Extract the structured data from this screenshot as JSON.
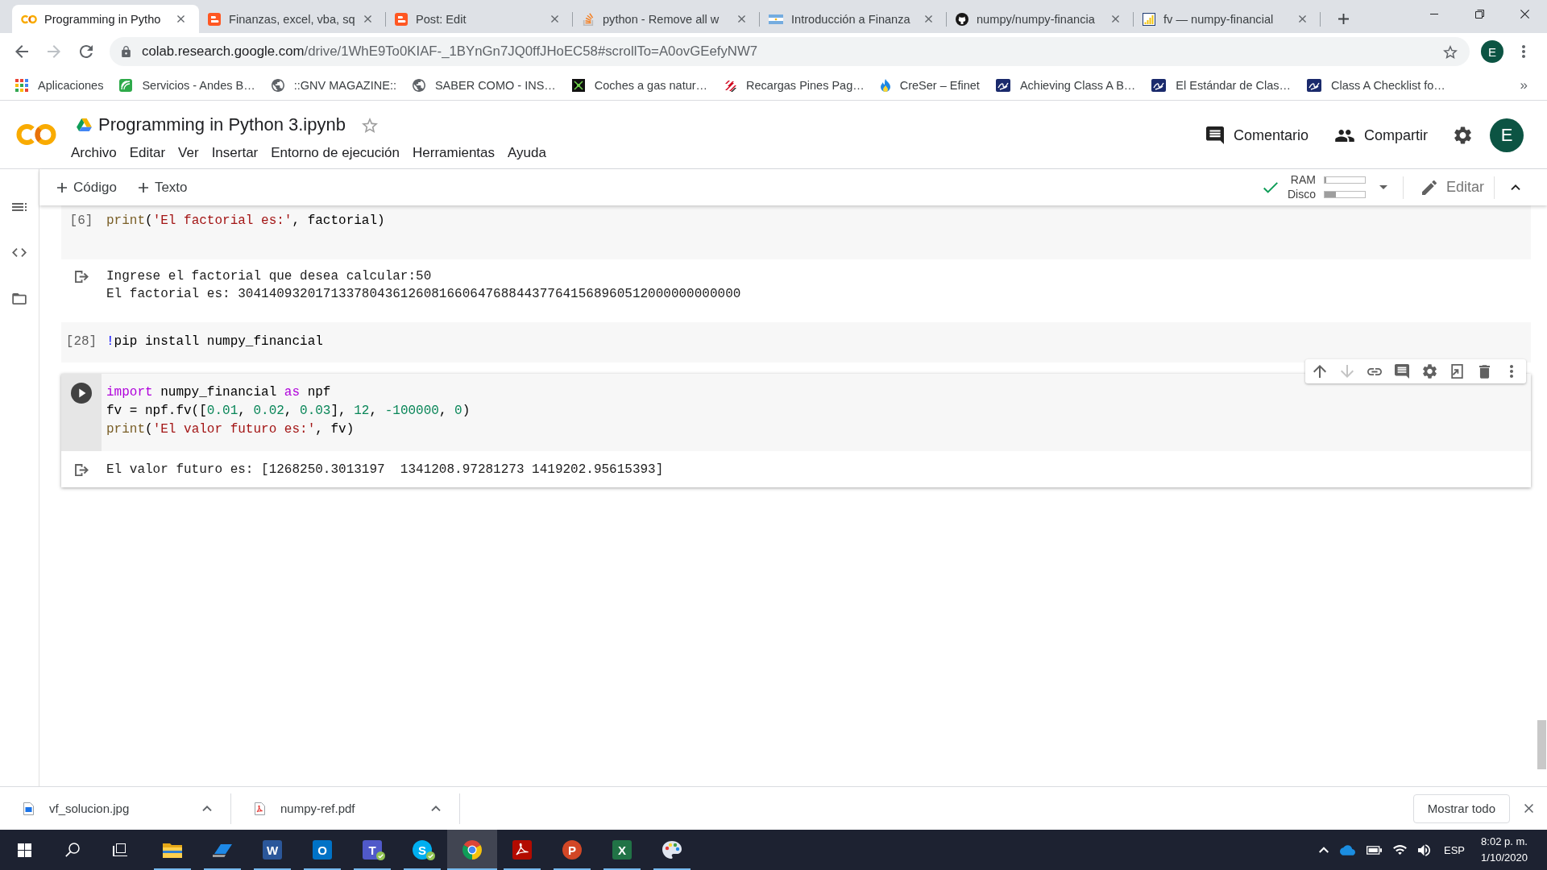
{
  "browser": {
    "tabs": [
      {
        "kind": "rings",
        "title": "Programming in Pytho",
        "selected": true
      },
      {
        "kind": "tile",
        "title": "Finanzas, excel, vba, sq",
        "selected": false
      },
      {
        "kind": "tile",
        "title": "Post: Edit",
        "selected": false
      },
      {
        "kind": "tray",
        "title": "python - Remove all w",
        "selected": false
      },
      {
        "kind": "flag",
        "title": "Introducción a Finanza",
        "selected": false
      },
      {
        "kind": "cat",
        "title": "numpy/numpy-financia",
        "selected": false
      },
      {
        "kind": "bars",
        "title": "fv — numpy-financial",
        "selected": false
      }
    ],
    "forward_disabled": true,
    "url": {
      "host": "colab.research.google.com",
      "path": "/drive/1WhE9To0KIAF-_1BYnGn7JQ0ffJHoEC58#scrollTo=A0ovGEefyNW7"
    },
    "profile": "E",
    "bookmarks": [
      {
        "kind": "grid",
        "label": "Aplicaciones"
      },
      {
        "kind": "arcs",
        "label": "Servicios - Andes B…"
      },
      {
        "kind": "globe",
        "label": "::GNV MAGAZINE::"
      },
      {
        "kind": "globe",
        "label": "SABER COMO - INS…"
      },
      {
        "kind": "nodes",
        "label": "Coches a gas natur…"
      },
      {
        "kind": "stripes",
        "label": "Recargas Pines Pag…"
      },
      {
        "kind": "flame",
        "label": "CreSer – Efinet"
      },
      {
        "kind": "emblem",
        "label": "Achieving Class A B…"
      },
      {
        "kind": "emblem",
        "label": "El Estándar de Clas…"
      },
      {
        "kind": "emblem",
        "label": "Class A Checklist fo…"
      }
    ],
    "bookmarks_overflow": "»"
  },
  "notebook": {
    "title": "Programming in Python 3.ipynb",
    "starred": false,
    "menu": [
      "Archivo",
      "Editar",
      "Ver",
      "Insertar",
      "Entorno de ejecución",
      "Herramientas",
      "Ayuda"
    ],
    "actions": [
      {
        "kind": "comment",
        "label": "Comentario"
      },
      {
        "kind": "share",
        "label": "Compartir"
      }
    ],
    "avatar": "E"
  },
  "toolbar": {
    "add": [
      "Código",
      "Texto"
    ],
    "connected": true,
    "meters": [
      {
        "label": "RAM",
        "level": 0.04
      },
      {
        "label": "Disco",
        "level": 0.28
      }
    ],
    "edit": "Editar"
  },
  "cells": [
    {
      "count": "[6]",
      "selected": false,
      "code": [
        [
          {
            "kind": "func",
            "text": "print"
          },
          {
            "kind": "plain",
            "text": "("
          },
          {
            "kind": "str",
            "text": "'El factorial es:'"
          },
          {
            "kind": "plain",
            "text": ", factorial)"
          }
        ]
      ],
      "output": [
        "Ingrese el factorial que desea calcular:50",
        "El factorial es: 30414093201713378043612608166064768844377641568960512000000000000"
      ]
    },
    {
      "count": "[28]",
      "selected": false,
      "code": [
        [
          {
            "kind": "magic",
            "text": "!"
          },
          {
            "kind": "plain",
            "text": "pip install numpy_financial"
          }
        ]
      ]
    },
    {
      "selected": true,
      "code": [
        [
          {
            "kind": "kw",
            "text": "import"
          },
          {
            "kind": "plain",
            "text": " numpy_financial "
          },
          {
            "kind": "kw",
            "text": "as"
          },
          {
            "kind": "plain",
            "text": " npf"
          }
        ],
        [
          {
            "kind": "plain",
            "text": "fv = npf.fv(["
          },
          {
            "kind": "num",
            "text": "0.01"
          },
          {
            "kind": "plain",
            "text": ", "
          },
          {
            "kind": "num",
            "text": "0.02"
          },
          {
            "kind": "plain",
            "text": ", "
          },
          {
            "kind": "num",
            "text": "0.03"
          },
          {
            "kind": "plain",
            "text": "], "
          },
          {
            "kind": "num",
            "text": "12"
          },
          {
            "kind": "plain",
            "text": ", "
          },
          {
            "kind": "num",
            "text": "-100000"
          },
          {
            "kind": "plain",
            "text": ", "
          },
          {
            "kind": "num",
            "text": "0"
          },
          {
            "kind": "plain",
            "text": ")"
          }
        ],
        [
          {
            "kind": "func",
            "text": "print"
          },
          {
            "kind": "plain",
            "text": "("
          },
          {
            "kind": "str",
            "text": "'El valor futuro es:'"
          },
          {
            "kind": "plain",
            "text": ", fv)"
          }
        ]
      ],
      "output": [
        "El valor futuro es: [1268250.3013197  1341208.97281273 1419202.95615393]"
      ]
    }
  ],
  "cell_toolbar": [
    {
      "kind": "up",
      "disabled": false
    },
    {
      "kind": "down",
      "disabled": true
    },
    {
      "kind": "link",
      "disabled": false
    },
    {
      "kind": "comment",
      "disabled": false
    },
    {
      "kind": "settings",
      "disabled": false
    },
    {
      "kind": "mirror",
      "disabled": false
    },
    {
      "kind": "delete",
      "disabled": false
    },
    {
      "kind": "more",
      "disabled": false
    }
  ],
  "downloads": {
    "items": [
      {
        "kind": "image",
        "name": "vf_solucion.jpg"
      },
      {
        "kind": "pdf",
        "name": "numpy-ref.pdf"
      }
    ],
    "show_all": "Mostrar todo"
  },
  "taskbar": {
    "apps": [
      {
        "kind": "folder",
        "running": true,
        "selected": false,
        "badge": false
      },
      {
        "kind": "stylus",
        "running": true,
        "selected": false,
        "badge": false
      },
      {
        "kind": "tile",
        "letter": "W",
        "color": "#2b579a",
        "running": true,
        "selected": false,
        "badge": false
      },
      {
        "kind": "tile",
        "letter": "O",
        "color": "#0072c6",
        "running": true,
        "selected": false,
        "badge": false
      },
      {
        "kind": "tile",
        "letter": "T",
        "color": "#5059c9",
        "running": true,
        "selected": false,
        "badge": true
      },
      {
        "kind": "round",
        "letter": "S",
        "color": "#00aff0",
        "running": true,
        "selected": false,
        "badge": true
      },
      {
        "kind": "chrome",
        "running": true,
        "selected": true,
        "badge": false
      },
      {
        "kind": "acrobat",
        "running": true,
        "selected": false,
        "badge": false
      },
      {
        "kind": "round",
        "letter": "P",
        "color": "#d24726",
        "running": true,
        "selected": false,
        "badge": false
      },
      {
        "kind": "tile",
        "letter": "X",
        "color": "#217346",
        "running": true,
        "selected": false,
        "badge": false
      },
      {
        "kind": "palette",
        "running": true,
        "selected": false,
        "badge": false
      }
    ],
    "language": "ESP",
    "time": "8:02 p. m.",
    "date": "1/10/2020"
  }
}
